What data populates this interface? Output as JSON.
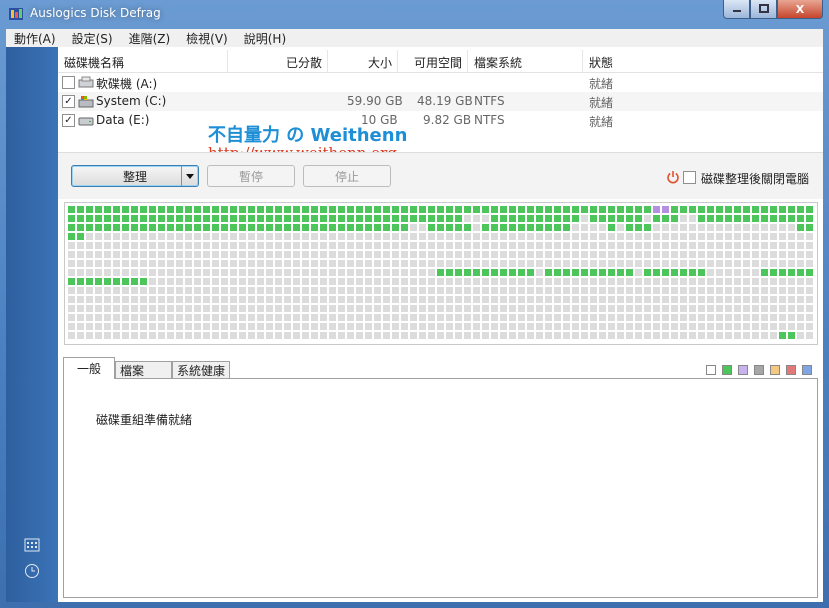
{
  "window": {
    "title": "Auslogics Disk Defrag",
    "close_label": "X"
  },
  "menu": [
    "動作(A)",
    "設定(S)",
    "進階(Z)",
    "檢視(V)",
    "說明(H)"
  ],
  "columns": [
    "磁碟機名稱",
    "已分散",
    "大小",
    "可用空間",
    "檔案系統",
    "狀態"
  ],
  "drives": [
    {
      "name": "軟碟機 (A:)",
      "checked": false,
      "fragmented": "",
      "size": "",
      "free": "",
      "fs": "",
      "status": "就緒"
    },
    {
      "name": "System (C:)",
      "checked": true,
      "fragmented": "",
      "size": "59.90 GB",
      "free": "48.19 GB",
      "fs": "NTFS",
      "status": "就緒"
    },
    {
      "name": "Data (E:)",
      "checked": true,
      "fragmented": "",
      "size": "10 GB",
      "free": "9.82 GB",
      "fs": "NTFS",
      "status": "就緒"
    }
  ],
  "watermark": {
    "line1": "不自量力 の Weithenn",
    "line2": "http://www.weithenn.org"
  },
  "toolbar": {
    "defrag": "整理",
    "pause": "暫停",
    "stop": "停止",
    "shutdown_label": "磁碟整理後關閉電腦"
  },
  "tabs": [
    "一般",
    "檔案 (C:)",
    "系統健康"
  ],
  "status_text": "磁碟重組準備就緒",
  "colors": {
    "used": "#4cc65a",
    "free": "#dcdcdc",
    "special": "#b58fe0",
    "accent": "#1e8fd6"
  },
  "legend_colors": [
    "#ffffff",
    "#4cc65a",
    "#c9b3ef",
    "#a6a6a6",
    "#f2c883",
    "#e27878",
    "#7fa6e2"
  ]
}
